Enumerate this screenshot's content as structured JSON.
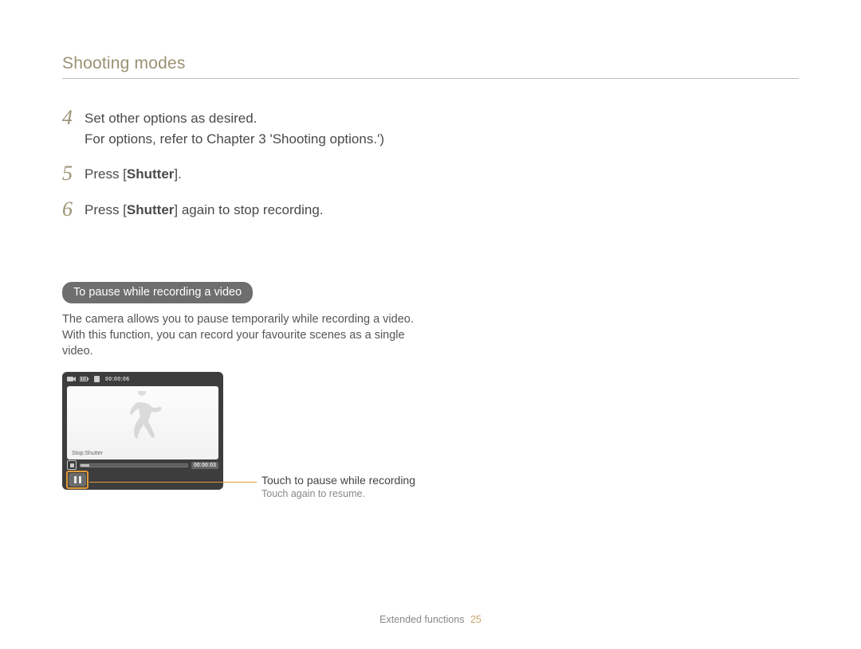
{
  "header": {
    "section_title": "Shooting modes"
  },
  "steps": [
    {
      "num": "4",
      "line1": "Set other options as desired.",
      "line2_pre": "For options, refer to Chapter 3 'Shooting options.')"
    },
    {
      "num": "5",
      "line1_pre": "Press [",
      "line1_bold": "Shutter",
      "line1_post": "]."
    },
    {
      "num": "6",
      "line1_pre": "Press [",
      "line1_bold": "Shutter",
      "line1_post": "] again to stop recording."
    }
  ],
  "pill": {
    "label": "To pause while recording a video"
  },
  "paragraph": "The camera allows you to pause temporarily while recording a video. With this function, you can record your favourite scenes as a single video.",
  "camshot": {
    "mode_icon": "video-mode-icon",
    "battery_icon": "battery-icon",
    "card_icon": "memory-card-icon",
    "top_timecode": "00:00:06",
    "stop_label": "Stop:Shutter",
    "bottom_timecode": "00:00:03",
    "pause_button": "pause-button"
  },
  "callout": {
    "main": "Touch to pause while recording",
    "sub": "Touch again to resume."
  },
  "footer": {
    "section": "Extended functions",
    "page": "25"
  }
}
